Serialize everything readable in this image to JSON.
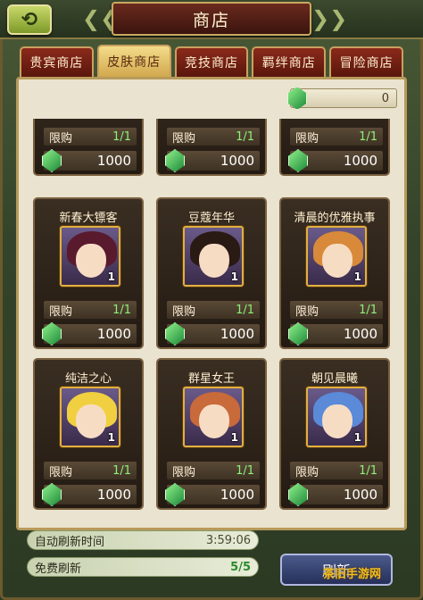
{
  "header": {
    "back_glyph": "⟲",
    "title": "商店",
    "deco_left": "❮❮",
    "deco_right": "❯❯"
  },
  "tabs": [
    {
      "label": "贵宾商店",
      "active": false
    },
    {
      "label": "皮肤商店",
      "active": true
    },
    {
      "label": "竞技商店",
      "active": false
    },
    {
      "label": "羁绊商店",
      "active": false
    },
    {
      "label": "冒险商店",
      "active": false
    }
  ],
  "currency": {
    "value": "0",
    "icon": "gem-icon",
    "color": "#3ac45a"
  },
  "items": [
    {
      "name": "",
      "count": "",
      "limit_label": "限购",
      "limit": "1/1",
      "price": "1000",
      "partial": true
    },
    {
      "name": "",
      "count": "",
      "limit_label": "限购",
      "limit": "1/1",
      "price": "1000",
      "partial": true
    },
    {
      "name": "",
      "count": "",
      "limit_label": "限购",
      "limit": "1/1",
      "price": "1000",
      "partial": true
    },
    {
      "name": "新春大镖客",
      "count": "1",
      "limit_label": "限购",
      "limit": "1/1",
      "price": "1000",
      "hair": "#5a1a2e"
    },
    {
      "name": "豆蔻年华",
      "count": "1",
      "limit_label": "限购",
      "limit": "1/1",
      "price": "1000",
      "hair": "#2a1a14"
    },
    {
      "name": "清晨的优雅执事",
      "count": "1",
      "limit_label": "限购",
      "limit": "1/1",
      "price": "1000",
      "hair": "#d88a3a"
    },
    {
      "name": "纯洁之心",
      "count": "1",
      "limit_label": "限购",
      "limit": "1/1",
      "price": "1000",
      "hair": "#f0d040"
    },
    {
      "name": "群星女王",
      "count": "1",
      "limit_label": "限购",
      "limit": "1/1",
      "price": "1000",
      "hair": "#c86a3a"
    },
    {
      "name": "朝见晨曦",
      "count": "1",
      "limit_label": "限购",
      "limit": "1/1",
      "price": "1000",
      "hair": "#5a8ad8"
    }
  ],
  "footer": {
    "auto_refresh_label": "自动刷新时间",
    "auto_refresh_value": "3:59:06",
    "free_refresh_label": "免费刷新",
    "free_refresh_value": "5/5",
    "refresh_button": "刷新"
  },
  "watermark": "茶旧手游网"
}
